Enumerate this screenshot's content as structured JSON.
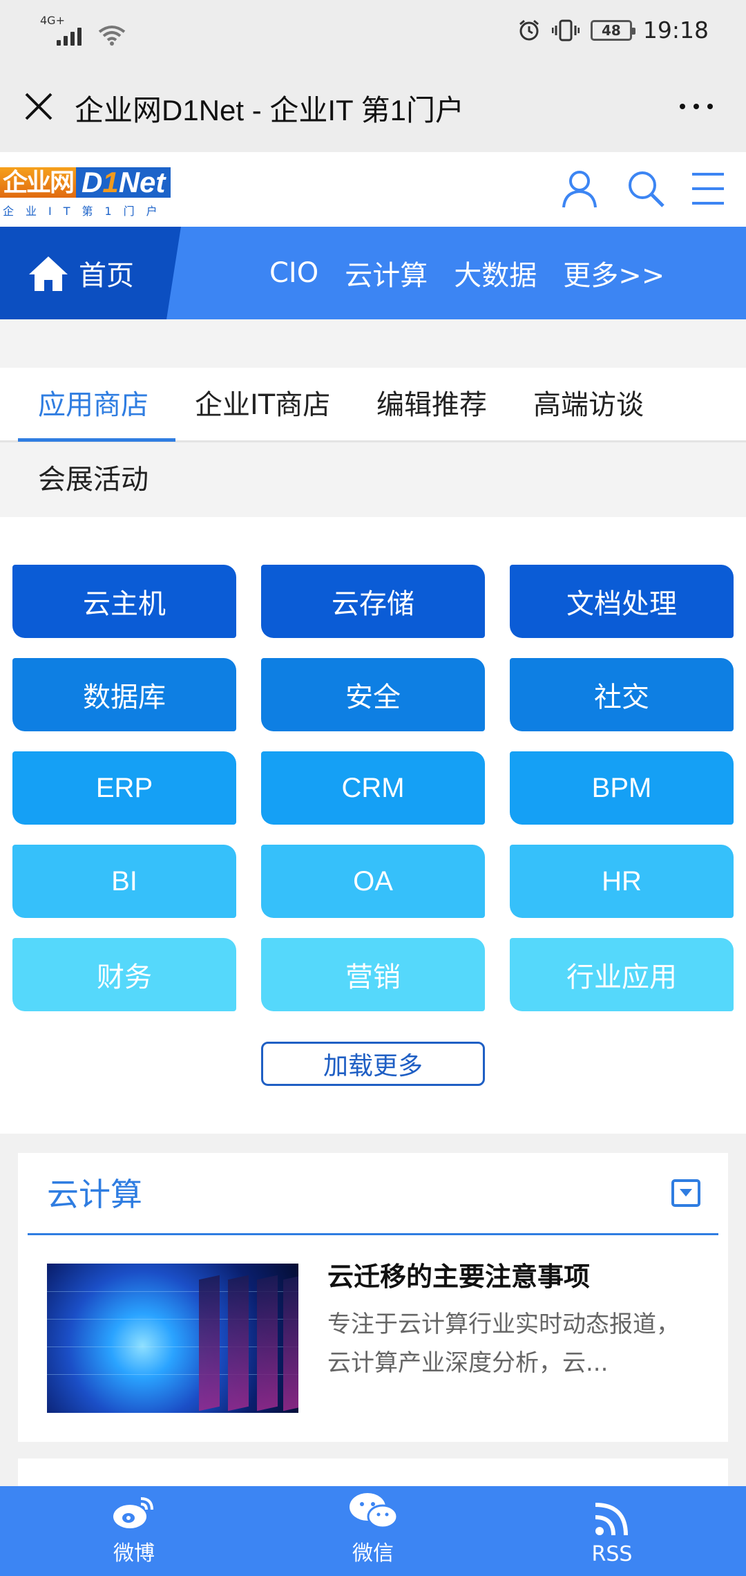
{
  "status_bar": {
    "network": "4G+",
    "battery": "48",
    "time": "19:18"
  },
  "title_bar": {
    "title": "企业网D1Net - 企业IT 第1门户"
  },
  "logo": {
    "cn": "企业网",
    "en_prefix": "D",
    "en_one": "1",
    "en_suffix": "Net",
    "sub": "企业IT第1门户"
  },
  "nav": {
    "home": "首页",
    "links": [
      "CIO",
      "云计算",
      "大数据",
      "更多>>"
    ]
  },
  "tabs": [
    "应用商店",
    "企业IT商店",
    "编辑推荐",
    "高端访谈",
    "会展活动"
  ],
  "categories": [
    {
      "label": "云主机",
      "color": "#0b5cd6"
    },
    {
      "label": "云存储",
      "color": "#0b5cd6"
    },
    {
      "label": "文档处理",
      "color": "#0b5cd6"
    },
    {
      "label": "数据库",
      "color": "#0e7fe3"
    },
    {
      "label": "安全",
      "color": "#0e7fe3"
    },
    {
      "label": "社交",
      "color": "#0e7fe3"
    },
    {
      "label": "ERP",
      "color": "#15a0f5"
    },
    {
      "label": "CRM",
      "color": "#15a0f5"
    },
    {
      "label": "BPM",
      "color": "#15a0f5"
    },
    {
      "label": "BI",
      "color": "#36c0fa"
    },
    {
      "label": "OA",
      "color": "#36c0fa"
    },
    {
      "label": "HR",
      "color": "#36c0fa"
    },
    {
      "label": "财务",
      "color": "#55d8fb"
    },
    {
      "label": "营销",
      "color": "#55d8fb"
    },
    {
      "label": "行业应用",
      "color": "#55d8fb"
    }
  ],
  "load_more": "加载更多",
  "section": {
    "title": "云计算",
    "article": {
      "title": "云迁移的主要注意事项",
      "desc": "专注于云计算行业实时动态报道，云计算产业深度分析，云..."
    }
  },
  "footer": [
    "微博",
    "微信",
    "RSS"
  ],
  "colors": {
    "accent": "#3c85f3",
    "nav_dark": "#0c4fc1",
    "link": "#2f7de1"
  }
}
